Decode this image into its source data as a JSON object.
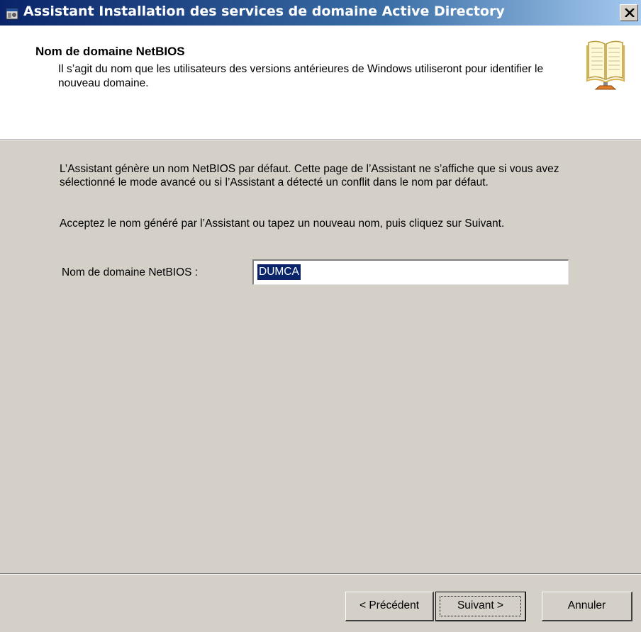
{
  "window": {
    "title": "Assistant Installation des services de domaine Active Directory",
    "icon": "wizard-app-icon",
    "close_icon": "close-icon"
  },
  "header": {
    "heading": "Nom de domaine NetBIOS",
    "subtitle": "Il s’agit du nom que les utilisateurs des versions antérieures de Windows utiliseront pour identifier le nouveau domaine.",
    "icon": "book-icon"
  },
  "body": {
    "paragraph1": "L’Assistant génère un nom NetBIOS par défaut. Cette page de l’Assistant ne s’affiche que si vous avez sélectionné le mode avancé ou si l’Assistant a détecté un conflit dans le nom par défaut.",
    "paragraph2": "Acceptez le nom généré par l’Assistant ou tapez un nouveau nom, puis cliquez sur Suivant.",
    "netbios_label": "Nom de domaine NetBIOS :",
    "netbios_value": "DUMCA"
  },
  "buttons": {
    "previous": "< Précédent",
    "next": "Suivant >",
    "cancel": "Annuler"
  },
  "colors": {
    "titlebar_start": "#0a246a",
    "titlebar_end": "#a6caf0",
    "dialog_face": "#d4d0c8",
    "selection": "#0a246a"
  }
}
